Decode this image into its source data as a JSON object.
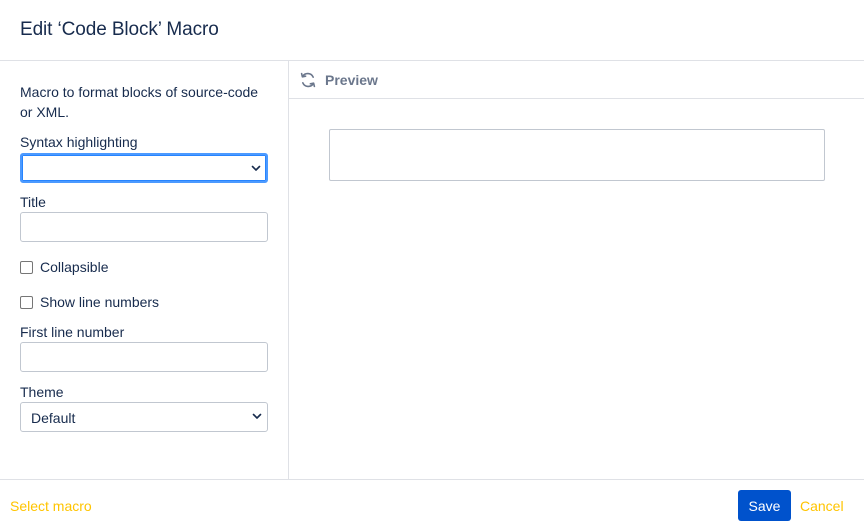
{
  "dialog": {
    "title": "Edit ‘Code Block’ Macro"
  },
  "form": {
    "description": "Macro to format blocks of source-code or XML.",
    "syntax": {
      "label": "Syntax highlighting",
      "value": ""
    },
    "title_field": {
      "label": "Title",
      "value": ""
    },
    "collapsible": {
      "label": "Collapsible",
      "checked": false
    },
    "line_numbers": {
      "label": "Show line numbers",
      "checked": false
    },
    "first_line": {
      "label": "First line number",
      "value": ""
    },
    "theme": {
      "label": "Theme",
      "value": "Default"
    }
  },
  "preview": {
    "label": "Preview",
    "icon": "refresh-icon"
  },
  "footer": {
    "select_macro": "Select macro",
    "save": "Save",
    "cancel": "Cancel"
  },
  "colors": {
    "primary": "#0052cc",
    "link": "#ffc400",
    "focus": "#4c9aff",
    "text": "#172b4d",
    "muted": "#6b778c"
  }
}
